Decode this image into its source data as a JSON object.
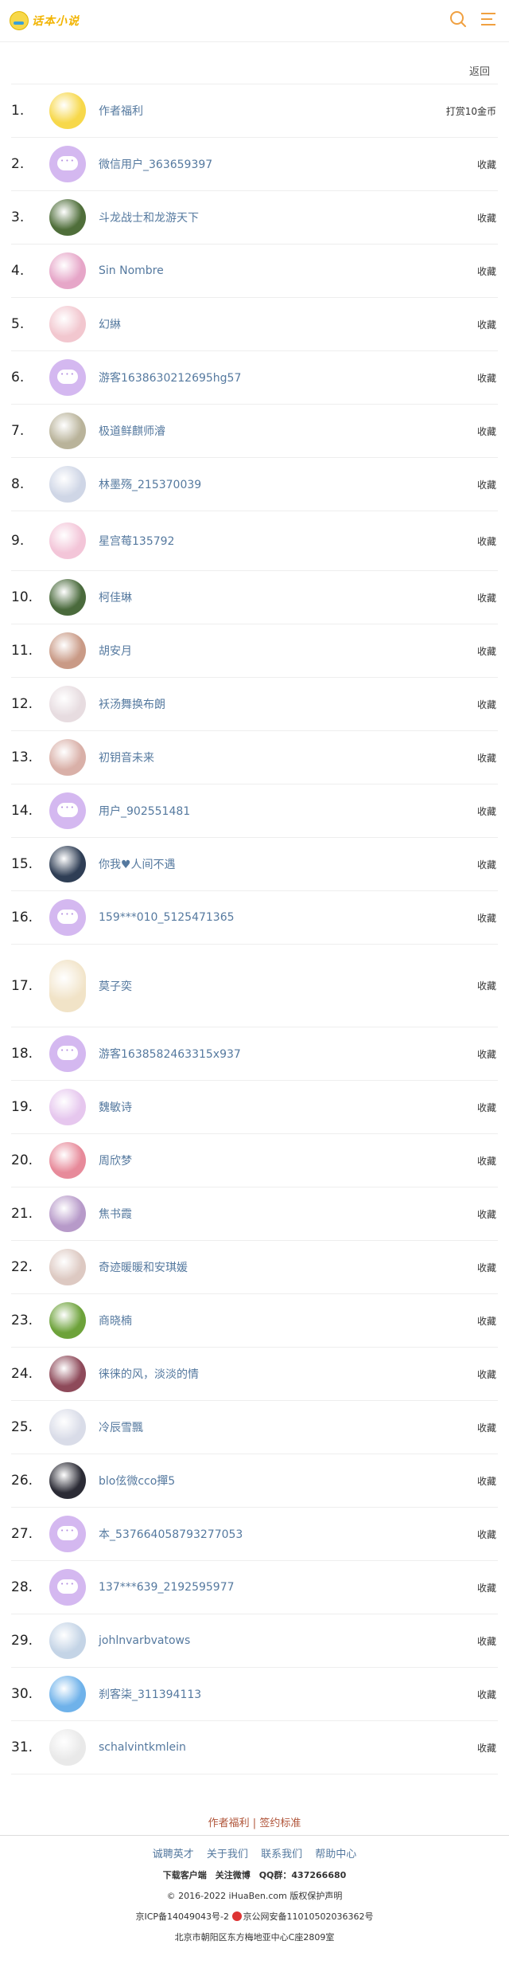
{
  "header": {
    "logo_text": "话本小说",
    "search_icon": "search-icon",
    "menu_icon": "menu-icon"
  },
  "back_label": "返回",
  "rows": [
    {
      "rank": "1.",
      "name": "作者福利",
      "action": "打赏10金币",
      "avatar": "logo",
      "color": "#f7d84a"
    },
    {
      "rank": "2.",
      "name": "微信用户_363659397",
      "action": "收藏",
      "avatar": "bubble",
      "color": "#d4b8f0"
    },
    {
      "rank": "3.",
      "name": "斗龙战士和龙游天下",
      "action": "收藏",
      "avatar": "photo",
      "color": "#4f6e3a"
    },
    {
      "rank": "4.",
      "name": "Sin Nombre",
      "action": "收藏",
      "avatar": "photo",
      "color": "#e6a6c8"
    },
    {
      "rank": "5.",
      "name": "幻綝",
      "action": "收藏",
      "avatar": "photo",
      "color": "#f2c7cf"
    },
    {
      "rank": "6.",
      "name": "游客1638630212695hg57",
      "action": "收藏",
      "avatar": "bubble",
      "color": "#d4b8f0"
    },
    {
      "rank": "7.",
      "name": "极道鲜麒师濬",
      "action": "收藏",
      "avatar": "photo",
      "color": "#b9b39a"
    },
    {
      "rank": "8.",
      "name": "林墨殇_215370039",
      "action": "收藏",
      "avatar": "photo",
      "color": "#cfd6e6"
    },
    {
      "rank": "9.",
      "name": "星宫莓135792",
      "action": "收藏",
      "avatar": "photo",
      "color": "#f3c5d8"
    },
    {
      "rank": "10.",
      "name": "柯佳琳",
      "action": "收藏",
      "avatar": "photo",
      "color": "#4a6a3c"
    },
    {
      "rank": "11.",
      "name": "胡安月",
      "action": "收藏",
      "avatar": "photo",
      "color": "#c99a86"
    },
    {
      "rank": "12.",
      "name": "袄汤舞换布朗",
      "action": "收藏",
      "avatar": "photo",
      "color": "#e7dce0"
    },
    {
      "rank": "13.",
      "name": "初钥音未来",
      "action": "收藏",
      "avatar": "photo",
      "color": "#d9b0a8"
    },
    {
      "rank": "14.",
      "name": "用户_902551481",
      "action": "收藏",
      "avatar": "bubble",
      "color": "#d4b8f0"
    },
    {
      "rank": "15.",
      "name": "你我♥人间不遇",
      "action": "收藏",
      "avatar": "photo",
      "color": "#2f3e55"
    },
    {
      "rank": "16.",
      "name": "159***010_5125471365",
      "action": "收藏",
      "avatar": "bubble",
      "color": "#d4b8f0"
    },
    {
      "rank": "17.",
      "name": "莫子奕",
      "action": "收藏",
      "avatar": "tall",
      "color": "#f1e3c7"
    },
    {
      "rank": "18.",
      "name": "游客1638582463315x937",
      "action": "收藏",
      "avatar": "bubble",
      "color": "#d4b8f0"
    },
    {
      "rank": "19.",
      "name": "魏敏诗",
      "action": "收藏",
      "avatar": "photo",
      "color": "#e6c7ee"
    },
    {
      "rank": "20.",
      "name": "周欣梦",
      "action": "收藏",
      "avatar": "photo",
      "color": "#e78a9a"
    },
    {
      "rank": "21.",
      "name": "焦书霞",
      "action": "收藏",
      "avatar": "photo",
      "color": "#b79ac9"
    },
    {
      "rank": "22.",
      "name": "奇迹暖暖和安琪媛",
      "action": "收藏",
      "avatar": "photo",
      "color": "#ddc9c2"
    },
    {
      "rank": "23.",
      "name": "商晓楠",
      "action": "收藏",
      "avatar": "photo",
      "color": "#6da23a"
    },
    {
      "rank": "24.",
      "name": "徕徕的风，淡淡的情",
      "action": "收藏",
      "avatar": "photo",
      "color": "#8e4a5a"
    },
    {
      "rank": "25.",
      "name": "冷辰雪飄",
      "action": "收藏",
      "avatar": "photo",
      "color": "#d9dce8"
    },
    {
      "rank": "26.",
      "name": "blo伭微cco撣5",
      "action": "收藏",
      "avatar": "photo",
      "color": "#2b2b35"
    },
    {
      "rank": "27.",
      "name": "本_537664058793277053",
      "action": "收藏",
      "avatar": "bubble",
      "color": "#d4b8f0"
    },
    {
      "rank": "28.",
      "name": "137***639_2192595977",
      "action": "收藏",
      "avatar": "bubble",
      "color": "#d4b8f0"
    },
    {
      "rank": "29.",
      "name": "johlnvarbvatows",
      "action": "收藏",
      "avatar": "photo",
      "color": "#c4d4e6"
    },
    {
      "rank": "30.",
      "name": "刹客柒_311394113",
      "action": "收藏",
      "avatar": "photo",
      "color": "#6fb2ea"
    },
    {
      "rank": "31.",
      "name": "schalvintkmlein",
      "action": "收藏",
      "avatar": "photo",
      "color": "#e9e9e9"
    }
  ],
  "footer": {
    "links": "作者福利 | 签约标准",
    "nav": [
      "诚聘英才",
      "关于我们",
      "联系我们",
      "帮助中心"
    ],
    "app_line": "下载客户端　关注微博　QQ群：437266680",
    "copyright": "© 2016-2022 iHuaBen.com 版权保护声明",
    "icp": "京ICP备14049043号-2",
    "police": "京公网安备11010502036362号",
    "address": "北京市朝阳区东方梅地亚中心C座2809室"
  }
}
